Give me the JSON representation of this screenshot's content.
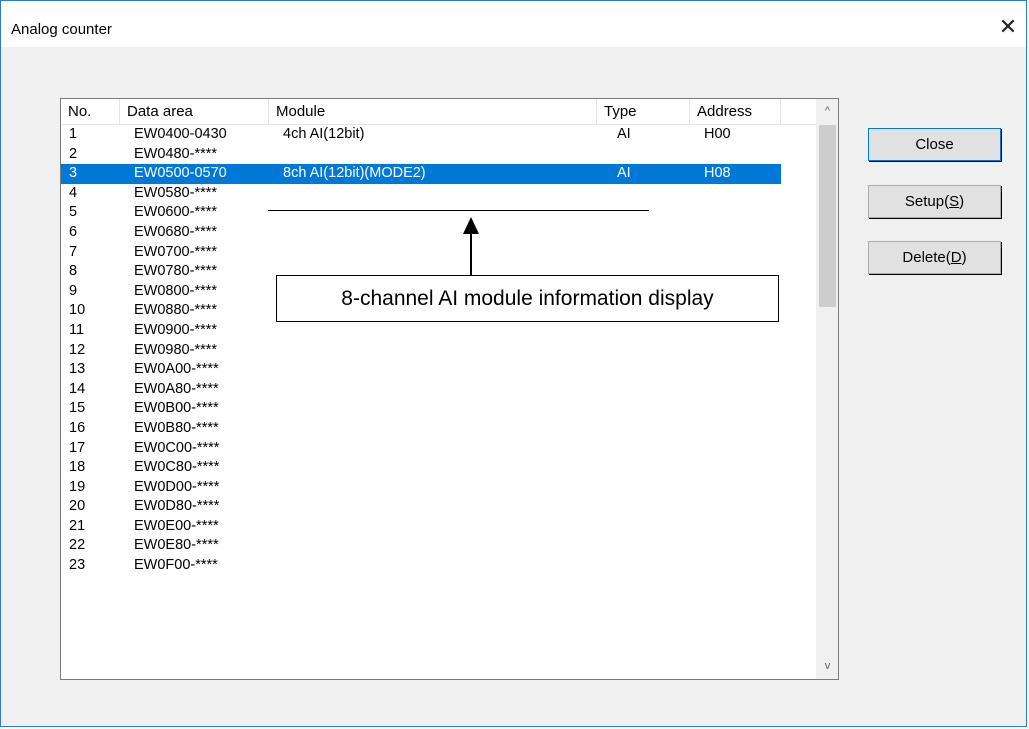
{
  "window": {
    "title": "Analog counter",
    "close_glyph": "✕"
  },
  "list": {
    "headers": {
      "no": "No.",
      "area": "Data area",
      "module": "Module",
      "type": "Type",
      "address": "Address"
    },
    "rows": [
      {
        "no": "1",
        "area": "EW0400-0430",
        "module": "4ch AI(12bit)",
        "type": "AI",
        "address": "H00"
      },
      {
        "no": "2",
        "area": "EW0480-****",
        "module": "",
        "type": "",
        "address": ""
      },
      {
        "no": "3",
        "area": "EW0500-0570",
        "module": "8ch AI(12bit)(MODE2)",
        "type": "AI",
        "address": "H08"
      },
      {
        "no": "4",
        "area": "EW0580-****",
        "module": "",
        "type": "",
        "address": ""
      },
      {
        "no": "5",
        "area": "EW0600-****",
        "module": "",
        "type": "",
        "address": ""
      },
      {
        "no": "6",
        "area": "EW0680-****",
        "module": "",
        "type": "",
        "address": ""
      },
      {
        "no": "7",
        "area": "EW0700-****",
        "module": "",
        "type": "",
        "address": ""
      },
      {
        "no": "8",
        "area": "EW0780-****",
        "module": "",
        "type": "",
        "address": ""
      },
      {
        "no": "9",
        "area": "EW0800-****",
        "module": "",
        "type": "",
        "address": ""
      },
      {
        "no": "10",
        "area": "EW0880-****",
        "module": "",
        "type": "",
        "address": ""
      },
      {
        "no": "11",
        "area": "EW0900-****",
        "module": "",
        "type": "",
        "address": ""
      },
      {
        "no": "12",
        "area": "EW0980-****",
        "module": "",
        "type": "",
        "address": ""
      },
      {
        "no": "13",
        "area": "EW0A00-****",
        "module": "",
        "type": "",
        "address": ""
      },
      {
        "no": "14",
        "area": "EW0A80-****",
        "module": "",
        "type": "",
        "address": ""
      },
      {
        "no": "15",
        "area": "EW0B00-****",
        "module": "",
        "type": "",
        "address": ""
      },
      {
        "no": "16",
        "area": "EW0B80-****",
        "module": "",
        "type": "",
        "address": ""
      },
      {
        "no": "17",
        "area": "EW0C00-****",
        "module": "",
        "type": "",
        "address": ""
      },
      {
        "no": "18",
        "area": "EW0C80-****",
        "module": "",
        "type": "",
        "address": ""
      },
      {
        "no": "19",
        "area": "EW0D00-****",
        "module": "",
        "type": "",
        "address": ""
      },
      {
        "no": "20",
        "area": "EW0D80-****",
        "module": "",
        "type": "",
        "address": ""
      },
      {
        "no": "21",
        "area": "EW0E00-****",
        "module": "",
        "type": "",
        "address": ""
      },
      {
        "no": "22",
        "area": "EW0E80-****",
        "module": "",
        "type": "",
        "address": ""
      },
      {
        "no": "23",
        "area": "EW0F00-****",
        "module": "",
        "type": "",
        "address": ""
      }
    ],
    "selected_row": "3",
    "scroll_up_glyph": "^",
    "scroll_down_glyph": "v"
  },
  "buttons": {
    "close": "Close",
    "setup_prefix": "Setup(",
    "setup_key": "S",
    "setup_suffix": ")",
    "delete_prefix": "Delete(",
    "delete_key": "D",
    "delete_suffix": ")"
  },
  "annotation": {
    "text": "8-channel AI module information display"
  },
  "icons": {
    "close": "close-icon",
    "arrow": "up-arrow-icon"
  },
  "colors": {
    "selection": "#0078d7",
    "border": "#2b7bd6"
  }
}
